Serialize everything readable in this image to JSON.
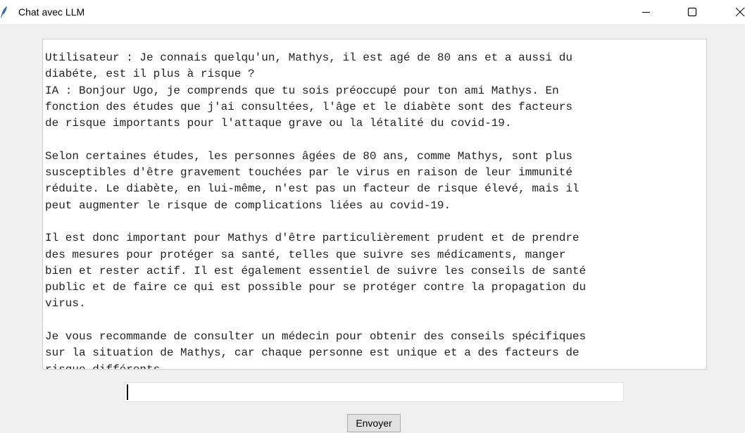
{
  "window": {
    "title": "Chat avec LLM",
    "icon": "feather-icon",
    "controls": [
      "minimize-icon",
      "maximize-icon",
      "close-icon"
    ]
  },
  "chat": {
    "lines": [
      "Utilisateur : Je connais quelqu'un, Mathys, il est agé de 80 ans et a aussi du",
      "diabéte, est il plus à risque ?",
      "IA : Bonjour Ugo, je comprends que tu sois préoccupé pour ton ami Mathys. En",
      "fonction des études que j'ai consultées, l'âge et le diabète sont des facteurs",
      "de risque importants pour l'attaque grave ou la létalité du covid-19.",
      "",
      "Selon certaines études, les personnes âgées de 80 ans, comme Mathys, sont plus",
      "susceptibles d'être gravement touchées par le virus en raison de leur immunité",
      "réduite. Le diabète, en lui-même, n'est pas un facteur de risque élevé, mais il",
      "peut augmenter le risque de complications liées au covid-19.",
      "",
      "Il est donc important pour Mathys d'être particulièrement prudent et de prendre",
      "des mesures pour protéger sa santé, telles que suivre ses médicaments, manger",
      "bien et rester actif. Il est également essentiel de suivre les conseils de santé",
      "public et de faire ce qui est possible pour se protéger contre la propagation du",
      "virus.",
      "",
      "Je vous recommande de consulter un médecin pour obtenir des conseils spécifiques",
      "sur la situation de Mathys, car chaque personne est unique et a des facteurs de",
      "risque différents."
    ]
  },
  "input": {
    "value": "",
    "placeholder": ""
  },
  "send_button": {
    "label": "Envoyer"
  }
}
